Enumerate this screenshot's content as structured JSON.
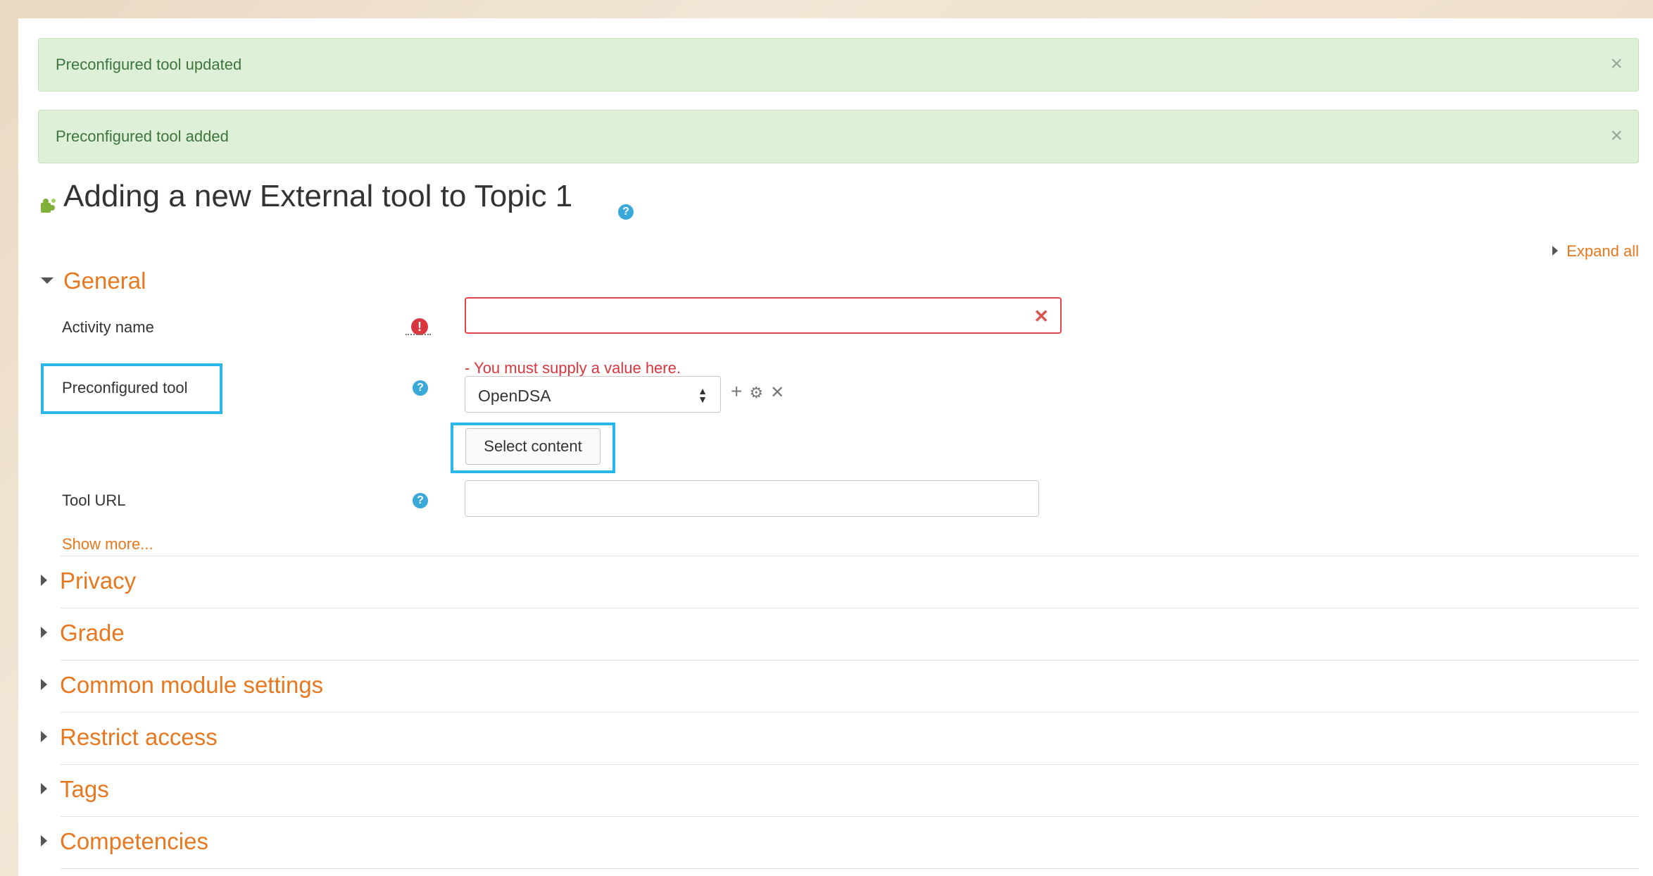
{
  "alerts": [
    {
      "text": "Preconfigured tool updated",
      "close": "×"
    },
    {
      "text": "Preconfigured tool added",
      "close": "×"
    }
  ],
  "page_title": "Adding a new External tool to Topic 1",
  "expand_all": "Expand all",
  "sections": {
    "general": "General",
    "privacy": "Privacy",
    "grade": "Grade",
    "common": "Common module settings",
    "restrict": "Restrict access",
    "tags": "Tags",
    "competencies": "Competencies"
  },
  "form": {
    "activity_name_label": "Activity name",
    "activity_name_value": "",
    "activity_name_error": "- You must supply a value here.",
    "preconfigured_label": "Preconfigured tool",
    "preconfigured_value": "OpenDSA",
    "select_content_label": "Select content",
    "tool_url_label": "Tool URL",
    "tool_url_value": "",
    "show_more": "Show more..."
  },
  "icons": {
    "required": "!",
    "help": "?",
    "add": "+",
    "gear": "⚙",
    "remove": "✕",
    "clear": "✕"
  },
  "colors": {
    "link": "#e8781f",
    "alert_bg": "#dff0d8",
    "error": "#e2444d",
    "highlight": "#29b6e8"
  }
}
